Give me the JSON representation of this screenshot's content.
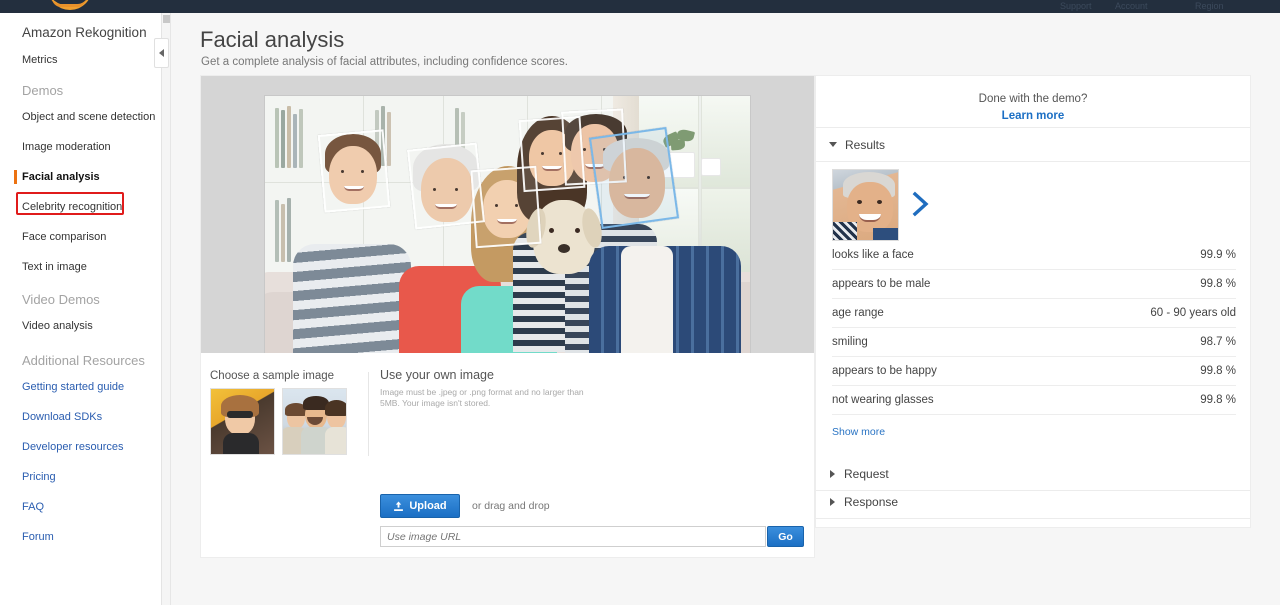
{
  "topbar": {
    "logo": "aws-logo",
    "right_items": [
      "Support",
      "Account",
      "Region"
    ]
  },
  "sidebar": {
    "service_title": "Amazon Rekognition",
    "metrics_label": "Metrics",
    "groups": [
      {
        "title": "Demos",
        "items": [
          {
            "label": "Object and scene detection",
            "state": "normal"
          },
          {
            "label": "Image moderation",
            "state": "normal"
          },
          {
            "label": "Facial analysis",
            "state": "selected"
          },
          {
            "label": "Celebrity recognition",
            "state": "normal"
          },
          {
            "label": "Face comparison",
            "state": "highlighted"
          },
          {
            "label": "Text in image",
            "state": "normal"
          }
        ]
      },
      {
        "title": "Video Demos",
        "items": [
          {
            "label": "Video analysis",
            "state": "normal"
          }
        ]
      },
      {
        "title": "Additional Resources",
        "items": [
          {
            "label": "Getting started guide",
            "state": "link"
          },
          {
            "label": "Download SDKs",
            "state": "link"
          },
          {
            "label": "Developer resources",
            "state": "link"
          },
          {
            "label": "Pricing",
            "state": "link"
          },
          {
            "label": "FAQ",
            "state": "link"
          },
          {
            "label": "Forum",
            "state": "link"
          }
        ]
      }
    ],
    "highlight_color": "#e01b1b",
    "accent_color": "#ec7211"
  },
  "page": {
    "title": "Facial analysis",
    "subtitle": "Get a complete analysis of facial attributes, including confidence scores."
  },
  "image_panel": {
    "sample_label": "Choose a sample image",
    "own_title": "Use your own image",
    "own_help": "Image must be .jpeg or .png format and no larger than 5MB. Your image isn't stored.",
    "upload_label": "Upload",
    "drag_text": "or drag and drop",
    "url_placeholder": "Use image URL",
    "url_value": "",
    "go_label": "Go",
    "detected_faces": 6,
    "selected_face_index": 5
  },
  "results": {
    "done_text": "Done with the demo?",
    "learn_more": "Learn more",
    "results_title": "Results",
    "attributes": [
      {
        "label": "looks like a face",
        "value": "99.9 %"
      },
      {
        "label": "appears to be male",
        "value": "99.8 %"
      },
      {
        "label": "age range",
        "value": "60 - 90 years old"
      },
      {
        "label": "smiling",
        "value": "98.7 %"
      },
      {
        "label": "appears to be happy",
        "value": "99.8 %"
      },
      {
        "label": "not wearing glasses",
        "value": "99.8 %"
      }
    ],
    "show_more": "Show more",
    "request_title": "Request",
    "response_title": "Response",
    "link_color": "#1c6fc4"
  }
}
